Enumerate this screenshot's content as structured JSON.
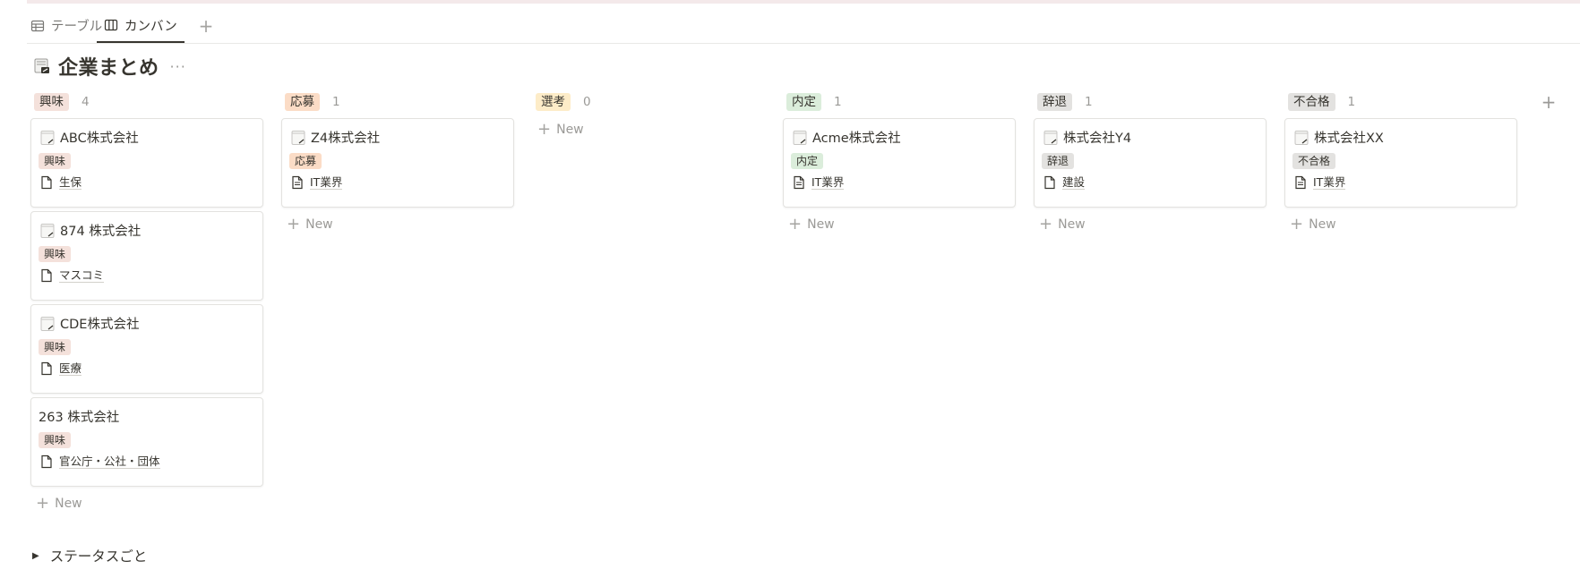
{
  "tabs": [
    {
      "label": "テーブル",
      "icon": "table-icon",
      "active": false
    },
    {
      "label": "カンバン",
      "icon": "board-icon",
      "active": true
    }
  ],
  "page": {
    "title": "企業まとめ",
    "icon": "database-icon",
    "more": "···"
  },
  "new_label": "New",
  "group_toggle": {
    "label": "ステータスごと"
  },
  "columns": [
    {
      "name": "興味",
      "count": "4",
      "color": "#f4e1db",
      "cards": [
        {
          "title": "ABC株式会社",
          "tag": "興味",
          "prop": "生保",
          "has_icon": true
        },
        {
          "title": "874 株式会社",
          "tag": "興味",
          "prop": "マスコミ",
          "has_icon": true
        },
        {
          "title": "CDE株式会社",
          "tag": "興味",
          "prop": "医療",
          "has_icon": true
        },
        {
          "title": "263 株式会社",
          "tag": "興味",
          "prop": "官公庁・公社・団体",
          "has_icon": false
        }
      ]
    },
    {
      "name": "応募",
      "count": "1",
      "color": "#fbdcc6",
      "cards": [
        {
          "title": "Z4株式会社",
          "tag": "応募",
          "prop": "IT業界",
          "has_icon": true
        }
      ]
    },
    {
      "name": "選考",
      "count": "0",
      "color": "#fdecc8",
      "cards": []
    },
    {
      "name": "内定",
      "count": "1",
      "color": "#dbeddb",
      "cards": [
        {
          "title": "Acme株式会社",
          "tag": "内定",
          "prop": "IT業界",
          "has_icon": true
        }
      ]
    },
    {
      "name": "辞退",
      "count": "1",
      "color": "#e3e2e0",
      "cards": [
        {
          "title": "株式会社Y4",
          "tag": "辞退",
          "prop": "建設",
          "has_icon": true
        }
      ]
    },
    {
      "name": "不合格",
      "count": "1",
      "color": "#e3e2e0",
      "cards": [
        {
          "title": "株式会社XX",
          "tag": "不合格",
          "prop": "IT業界",
          "has_icon": true
        }
      ]
    }
  ]
}
